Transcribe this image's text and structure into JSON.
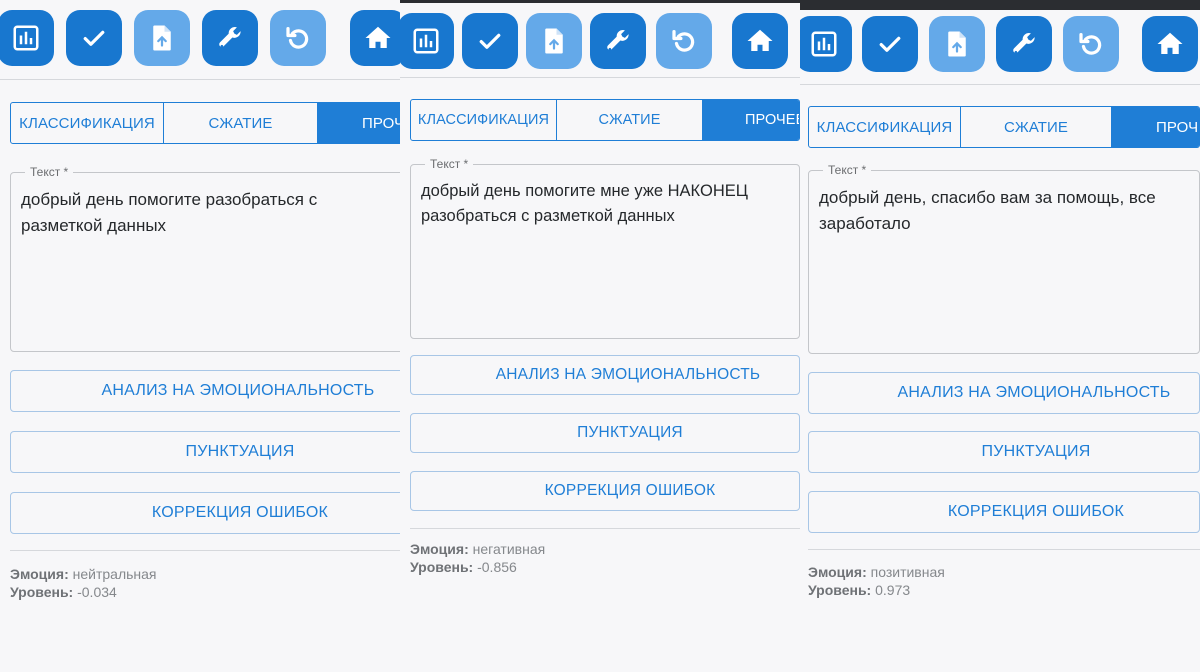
{
  "tabs": {
    "classification": "КЛАССИФИКАЦИЯ",
    "compression": "СЖАТИЕ",
    "other": "ПРОЧЕЕ"
  },
  "field_label": "Текст *",
  "buttons": {
    "emotion": "АНАЛИЗ НА ЭМОЦИОНАЛЬНОСТЬ",
    "punctuation": "ПУНКТУАЦИЯ",
    "correction": "КОРРЕКЦИЯ ОШИБОК"
  },
  "result_labels": {
    "emotion": "Эмоция:",
    "level": "Уровень:"
  },
  "panels": [
    {
      "text": "добрый день помогите разобраться с разметкой данных",
      "emotion": "нейтральная",
      "level": "-0.034"
    },
    {
      "text": "добрый день помогите мне уже НАКОНЕЦ разобраться с разметкой данных",
      "emotion": "негативная",
      "level": "-0.856"
    },
    {
      "text": "добрый день, спасибо вам за помощь, все заработало",
      "emotion": "позитивная",
      "level": "0.973"
    }
  ],
  "icons": [
    "chart-icon",
    "check-icon",
    "file-upload-icon",
    "wrench-icon",
    "undo-icon",
    "home-icon"
  ],
  "colors": {
    "primary": "#1877cf",
    "primary_light": "#64a9e9",
    "background": "#f7f7f9"
  }
}
